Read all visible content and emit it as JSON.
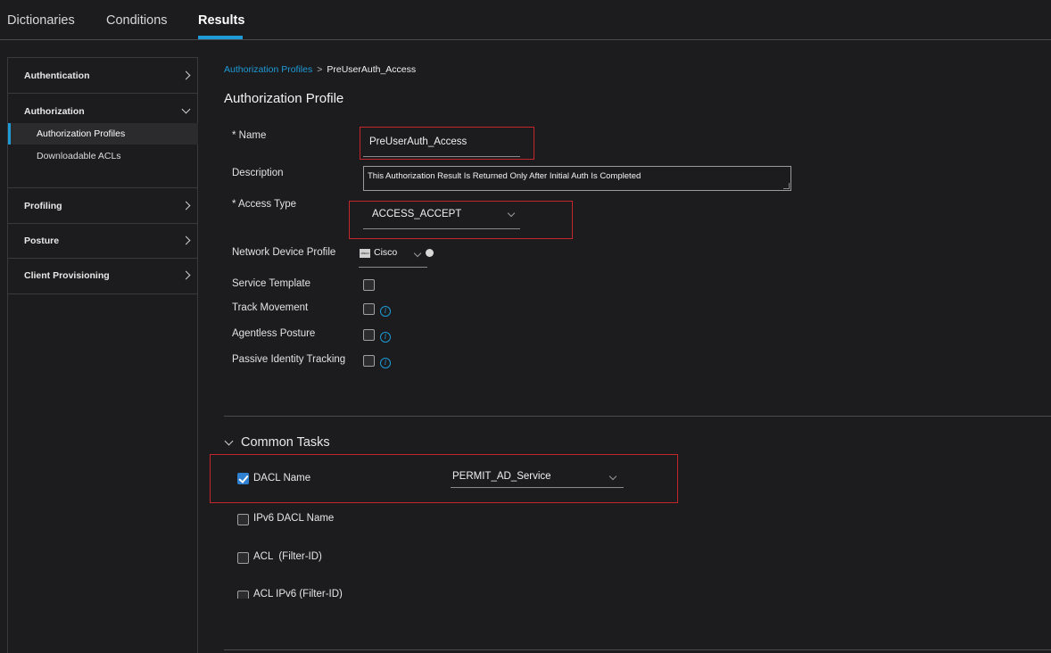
{
  "topnav": {
    "tabs": [
      "Dictionaries",
      "Conditions",
      "Results"
    ],
    "active": "Results"
  },
  "sidebar": {
    "sections": [
      "Authentication",
      "Authorization",
      "Profiling",
      "Posture",
      "Client Provisioning"
    ],
    "authorization_items": [
      "Authorization Profiles",
      "Downloadable ACLs"
    ],
    "active_item": "Authorization Profiles"
  },
  "breadcrumb": {
    "parent": "Authorization Profiles",
    "separator": ">",
    "current": "PreUserAuth_Access"
  },
  "page_title": "Authorization Profile",
  "form": {
    "name_label": "* Name",
    "name_value": "PreUserAuth_Access",
    "description_label": "Description",
    "description_value": "This Authorization Result Is Returned Only After Initial Auth Is Completed",
    "access_type_label": "* Access Type",
    "access_type_value": "ACCESS_ACCEPT",
    "ndp_label": "Network Device Profile",
    "ndp_value": "Cisco",
    "ndp_logo_text": "cisco",
    "service_template_label": "Service Template",
    "track_movement_label": "Track Movement",
    "agentless_posture_label": "Agentless Posture",
    "passive_identity_label": "Passive Identity Tracking",
    "info_glyph": "i"
  },
  "common_tasks": {
    "title": "Common Tasks",
    "dacl_label": "DACL Name",
    "dacl_checked": true,
    "dacl_value": "PERMIT_AD_Service",
    "ipv6_dacl_label": "IPv6 DACL Name",
    "acl_label": "ACL  (Filter-ID)",
    "acl_ipv6_label": "ACL IPv6 (Filter-ID)"
  },
  "colors": {
    "accent": "#1e9bd7",
    "highlight_box": "#c3272b",
    "background": "#1c1c1e"
  }
}
